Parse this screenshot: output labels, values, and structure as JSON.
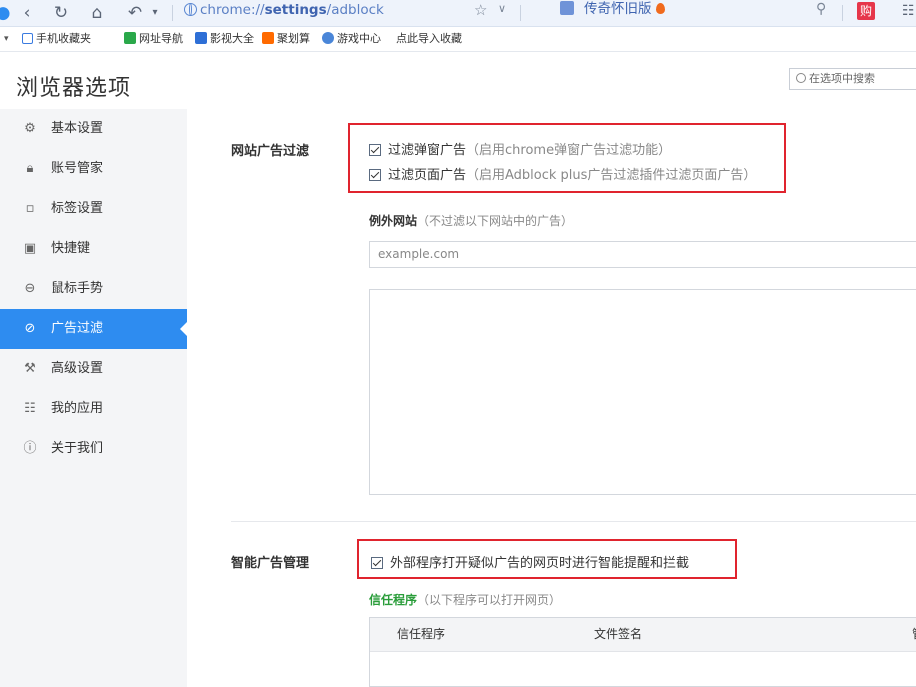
{
  "toolbar": {
    "address_prefix": "chrome://",
    "address_bold": "settings",
    "address_suffix": "/adblock",
    "promo_text": "传奇怀旧版",
    "red_button": "购"
  },
  "bookmarks": [
    {
      "label": "手机收藏夹",
      "color": "#3a7be0"
    },
    {
      "label": "网址导航",
      "color": "#2aa84a"
    },
    {
      "label": "影视大全",
      "color": "#2e6fd6"
    },
    {
      "label": "聚划算",
      "color": "#ff6a00"
    },
    {
      "label": "游戏中心",
      "color": "#4a86d8"
    },
    {
      "label": "点此导入收藏",
      "color": ""
    }
  ],
  "page": {
    "title": "浏览器选项",
    "search_placeholder": "在选项中搜索"
  },
  "sidebar": {
    "items": [
      {
        "label": "基本设置",
        "icon": "gear-icon"
      },
      {
        "label": "账号管家",
        "icon": "lock-icon"
      },
      {
        "label": "标签设置",
        "icon": "tabs-icon"
      },
      {
        "label": "快捷键",
        "icon": "keyboard-icon"
      },
      {
        "label": "鼠标手势",
        "icon": "mouse-icon"
      },
      {
        "label": "广告过滤",
        "icon": "block-icon",
        "active": true
      },
      {
        "label": "高级设置",
        "icon": "wrench-icon"
      },
      {
        "label": "我的应用",
        "icon": "apps-icon"
      },
      {
        "label": "关于我们",
        "icon": "info-icon"
      }
    ]
  },
  "adfilter": {
    "section_label": "网站广告过滤",
    "popup_label": "过滤弹窗广告",
    "popup_hint": "（启用chrome弹窗广告过滤功能）",
    "page_label": "过滤页面广告",
    "page_hint": "（启用Adblock plus广告过滤插件过滤页面广告）",
    "exception_title": "例外网站",
    "exception_hint": "（不过滤以下网站中的广告）",
    "exception_placeholder": "example.com"
  },
  "smart": {
    "section_label": "智能广告管理",
    "intercept_label": "外部程序打开疑似广告的网页时进行智能提醒和拦截",
    "trusted_title": "信任程序",
    "trusted_hint": "（以下程序可以打开网页）",
    "table_headers": [
      "信任程序",
      "文件签名",
      "管"
    ]
  },
  "colors": {
    "accent": "#2e8cf0",
    "highlight_box": "#e0242e",
    "green_title": "#2a9d3a"
  }
}
